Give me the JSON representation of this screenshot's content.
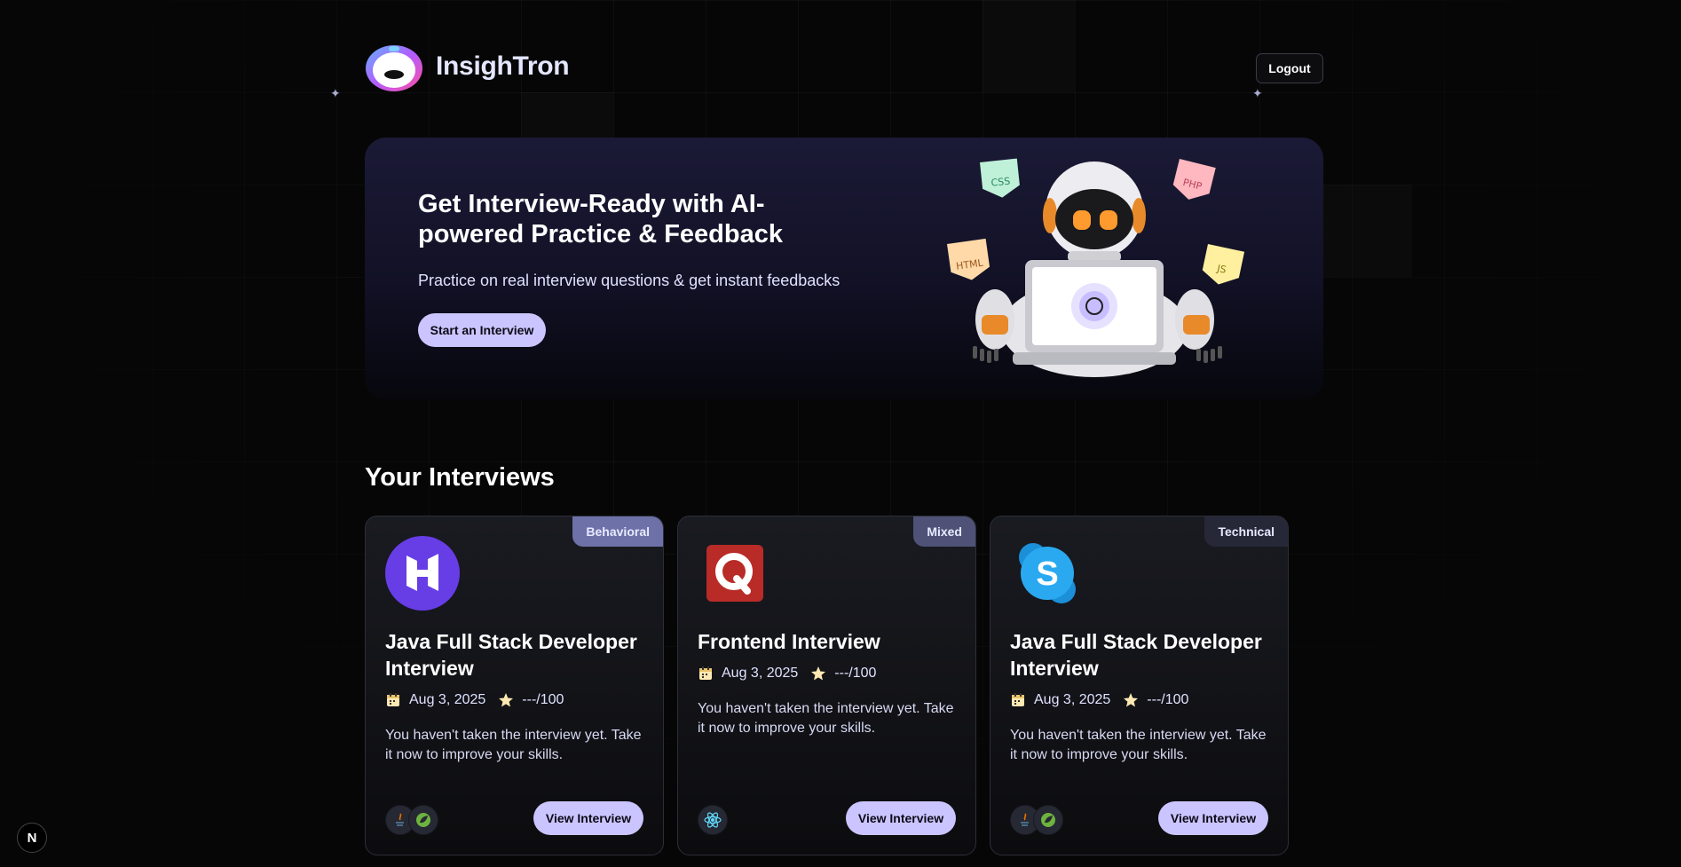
{
  "app": {
    "brand": "InsighTron",
    "logout_label": "Logout",
    "next_badge": "N"
  },
  "hero": {
    "title": "Get Interview-Ready with AI-powered Practice & Feedback",
    "subtitle": "Practice on real interview questions & get instant feedbacks",
    "cta_label": "Start an Interview",
    "tags": [
      "CSS",
      "PHP",
      "HTML",
      "JS"
    ]
  },
  "section": {
    "title": "Your Interviews"
  },
  "interviews": [
    {
      "type": "Behavioral",
      "badge_color": "#6d71a8",
      "logo": "hostinger-icon",
      "title": "Java Full Stack Developer Interview",
      "date": "Aug 3, 2025",
      "score": "---/100",
      "description": "You haven't taken the interview yet. Take it now to improve your skills.",
      "tech_icons": [
        "java-icon",
        "spring-icon"
      ],
      "button_label": "View Interview"
    },
    {
      "type": "Mixed",
      "badge_color": "#4f5276",
      "logo": "quora-icon",
      "title": "Frontend Interview",
      "date": "Aug 3, 2025",
      "score": "---/100",
      "description": "You haven't taken the interview yet. Take it now to improve your skills.",
      "tech_icons": [
        "react-icon"
      ],
      "button_label": "View Interview"
    },
    {
      "type": "Technical",
      "badge_color": "#262838",
      "logo": "skype-icon",
      "title": "Java Full Stack Developer Interview",
      "date": "Aug 3, 2025",
      "score": "---/100",
      "description": "You haven't taken the interview yet. Take it now to improve your skills.",
      "tech_icons": [
        "java-icon",
        "spring-icon"
      ],
      "button_label": "View Interview"
    }
  ],
  "colors": {
    "accent": "#cac5fe",
    "background": "#060607",
    "card": "#16171c"
  }
}
